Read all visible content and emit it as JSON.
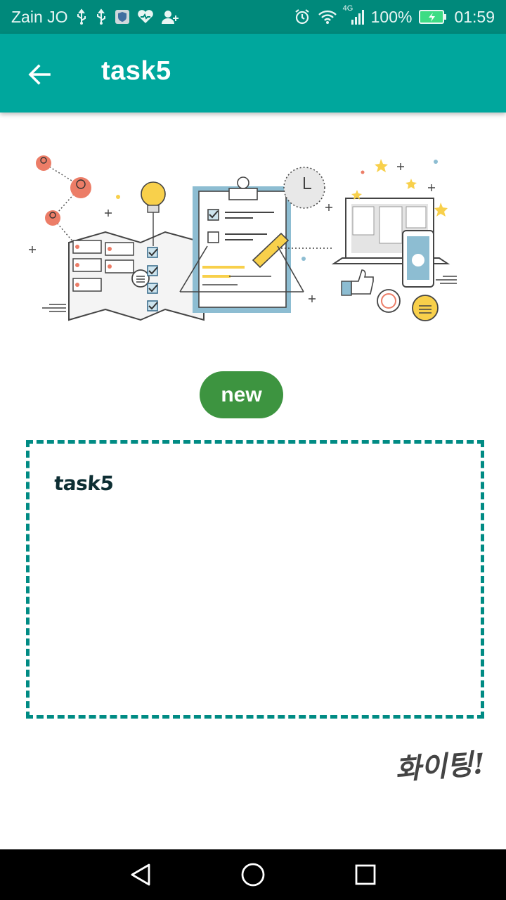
{
  "status_bar": {
    "carrier": "Zain JO",
    "network": "4G",
    "battery": "100%",
    "time": "01:59",
    "icons_left": [
      "usb-icon",
      "usb-icon",
      "shield-app-icon",
      "health-heart-icon",
      "add-contact-icon"
    ],
    "icons_right": [
      "alarm-icon",
      "wifi-icon",
      "signal-icon",
      "battery-charging-icon"
    ]
  },
  "app_bar": {
    "title": "task5",
    "background": "#00a79d"
  },
  "illustration": {
    "description_icon": "task-planning-illustration"
  },
  "actions": {
    "new_label": "new",
    "new_color": "#3d9440"
  },
  "note": {
    "text": "task5",
    "border_color": "#008b84"
  },
  "signature": {
    "text": "화이팅!"
  },
  "nav_bar": {
    "buttons": [
      "back-triangle-icon",
      "home-circle-icon",
      "recents-square-icon"
    ]
  }
}
